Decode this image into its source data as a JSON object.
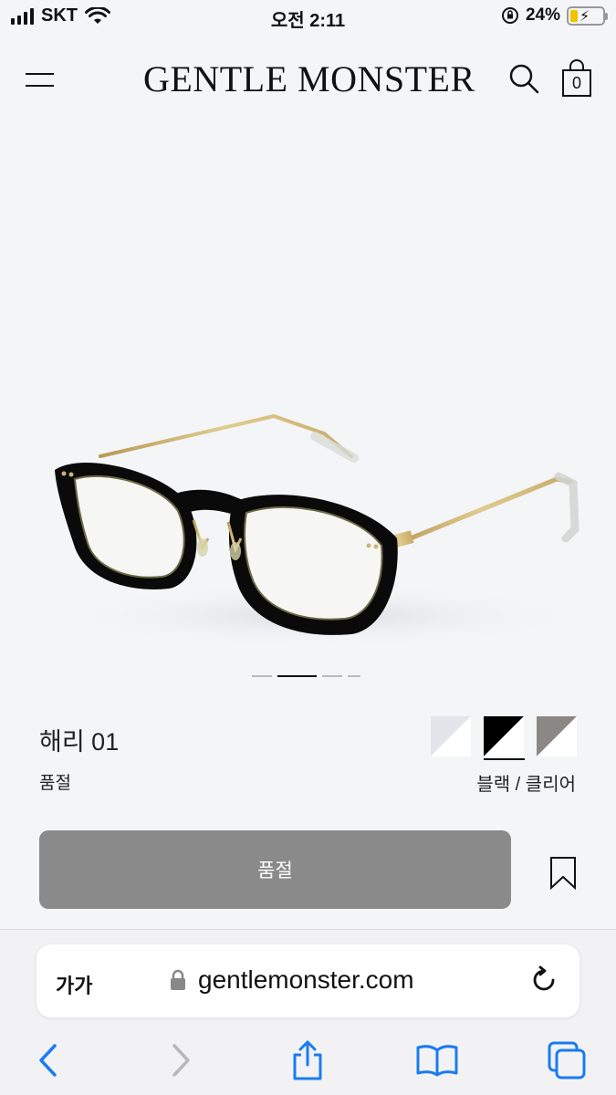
{
  "status_bar": {
    "carrier": "SKT",
    "time": "오전 2:11",
    "battery": "24%",
    "battery_level": 0.24
  },
  "header": {
    "logo": "GENTLE MONSTER",
    "cart_count": "0"
  },
  "gallery": {
    "image_alt": "black round eyeglasses with gold temples",
    "page_count": 4,
    "active_page": 2
  },
  "product": {
    "name": "해리 01",
    "status": "품절",
    "color_name": "블랙 / 클리어",
    "swatches": [
      {
        "name": "swatch-clear",
        "colors": [
          "#e3e5ea",
          "#ffffff"
        ]
      },
      {
        "name": "swatch-black",
        "colors": [
          "#000000",
          "#ffffff"
        ],
        "active": true
      },
      {
        "name": "swatch-gray",
        "colors": [
          "#8a8785",
          "#ffffff"
        ]
      }
    ]
  },
  "cta": {
    "label": "품절"
  },
  "safari": {
    "text_size_label": "가가",
    "url": "gentlemonster.com",
    "accent_color": "#1a7cf0"
  }
}
